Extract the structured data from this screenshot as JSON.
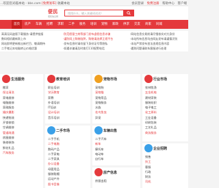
{
  "topbar": {
    "left_text": "…欢迎您光临本站 - bbs.com",
    "left_highlight": "[免费发布]",
    "left_tail": "收藏本站",
    "links": [
      "会员登录",
      "免费注册",
      "帮助中心",
      "客户端"
    ],
    "highlight_link": "免费注册"
  },
  "logo": {
    "name": "便民",
    "sub": "便民信息网"
  },
  "search": {
    "placeholder": "找找什么，输入关键词试试！"
  },
  "nav": {
    "items": [
      "首页",
      "房产",
      "车辆",
      "招聘",
      "求职",
      "二手",
      "服务",
      "培训",
      "宠物",
      "家政",
      "供求",
      "交友",
      "商家",
      "同城"
    ],
    "active_index": 0
  },
  "notices": {
    "left": [
      "高清无码盗版下载服务-请提供链接",
      "数码相机最新款上市",
      "网站即将更新推出新栏目、敬请期待",
      "二手笔记本电脑转让价格优惠"
    ],
    "middle": [
      "·防范假冒工商等部门发布虚假信息诈骗",
      "·谨防网上购物陷阱，购物请选择正规平台",
      "·发布信息时请勿留下身份证号等隐私",
      "·如遇诈骗请及时拨打110报警电话"
    ],
    "right": [
      "·网站信息交易前请仔细核实对方身份",
      "·本站所有信息均由网友发布请谨慎识别",
      "·本站严禁发布违法违规信息内容",
      "·遇到问题请联系客服进行处理"
    ]
  },
  "cards": [
    {
      "title": "生活服务",
      "color": "#e4393c",
      "items": [
        "搬家",
        "保洁清洗",
        "家电维修",
        "电脑维修",
        "家政服务",
        "婚庆摄影",
        "快递物流",
        "开锁修锁",
        "空调维修",
        "管道疏通",
        "房屋维修",
        "装修装饰",
        "鲜花礼品",
        "汽车服务"
      ]
    },
    {
      "title": "教育培训",
      "color": "#e4393c",
      "items": [
        "职业培训",
        "学历教育",
        "家教",
        "外语培训",
        "IT培训",
        "设计培训",
        "音乐培训",
        "舞蹈培训",
        "驾校"
      ]
    },
    {
      "title": "二手市场",
      "color": "#3aa0e8",
      "items": [
        "二手手机",
        "二手电脑",
        "数码产品",
        "二手家电",
        "二手家具",
        "办公设备",
        "母婴用品",
        "服装鞋帽",
        "运动户外",
        "图书音像"
      ]
    },
    {
      "title": "宠物市场",
      "color": "#f0a020",
      "items": [
        "宠物狗",
        "宠物猫",
        "宠物用品",
        "宠物服务",
        "水族",
        "花鸟鱼虫",
        "异宠",
        "宠物医院",
        "宠物美容",
        "宠物寄养"
      ]
    },
    {
      "title": "车辆出售",
      "color": "#3aa0e8",
      "items": [
        "二手汽车",
        "新车",
        "摩托车",
        "电动车",
        "自行车",
        "货车",
        "客车",
        "工程车",
        "汽车配件",
        "汽车用品",
        "驾校",
        "代驾",
        "汽车租赁"
      ]
    },
    {
      "title": "房产信息",
      "color": "#e4393c",
      "items": [
        "房屋出租",
        "求租",
        "二手房",
        "新房",
        "商铺",
        "写字楼"
      ]
    },
    {
      "title": "行业市场",
      "color": "#e4393c",
      "items": [
        "农林牧渔",
        "五金机电",
        "建材家装",
        "服装纺织",
        "电子电工",
        "化工原料",
        "工业设备",
        "印刷包装",
        "工艺礼品",
        "商务服务"
      ]
    },
    {
      "title": "企业招聘",
      "color": "#3aa0e8",
      "items": [
        "销售",
        "技工",
        "客服",
        "行政",
        "财务",
        "司机"
      ]
    },
    {
      "title": "商务服务",
      "color": "#e4393c",
      "items": [
        "工商注册",
        "财务会计",
        "法律咨询",
        "广告设计",
        "网站建设"
      ]
    }
  ]
}
